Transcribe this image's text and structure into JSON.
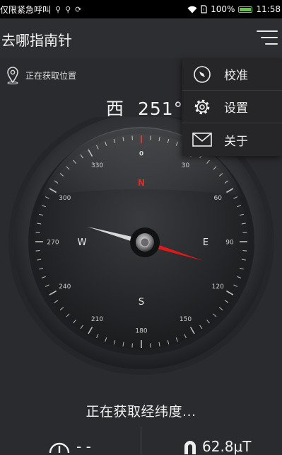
{
  "status_bar": {
    "carrier_text": "仅限紧急呼叫",
    "usb_icon_1": "usb-icon",
    "usb_icon_2": "usb-icon",
    "sync_icon": "sync-icon",
    "battery_percent": "100%",
    "battery_level": 1.0,
    "time": "11:58"
  },
  "app": {
    "title": "去哪指南针"
  },
  "location": {
    "status": "正在获取位置"
  },
  "heading": {
    "direction": "西",
    "degrees_text": "251°",
    "degrees": 251
  },
  "compass": {
    "north_label": "N",
    "east_label": "E",
    "south_label": "S",
    "west_label": "W",
    "degree_labels": [
      "0",
      "30",
      "60",
      "90",
      "120",
      "150",
      "180",
      "210",
      "240",
      "270",
      "300",
      "330"
    ],
    "needle_red_color": "#e01818",
    "needle_white_color": "#d8d8d8"
  },
  "menu": {
    "items": [
      {
        "label": "校准",
        "icon": "compass-icon"
      },
      {
        "label": "设置",
        "icon": "gear-icon"
      },
      {
        "label": "关于",
        "icon": "mail-icon"
      }
    ]
  },
  "coords": {
    "status": "正在获取经纬度..."
  },
  "stats": {
    "altitude_value": "- -",
    "altitude_icon": "gauge-icon",
    "magnetic_value": "62.8μT",
    "magnetic_icon": "magnet-icon"
  }
}
